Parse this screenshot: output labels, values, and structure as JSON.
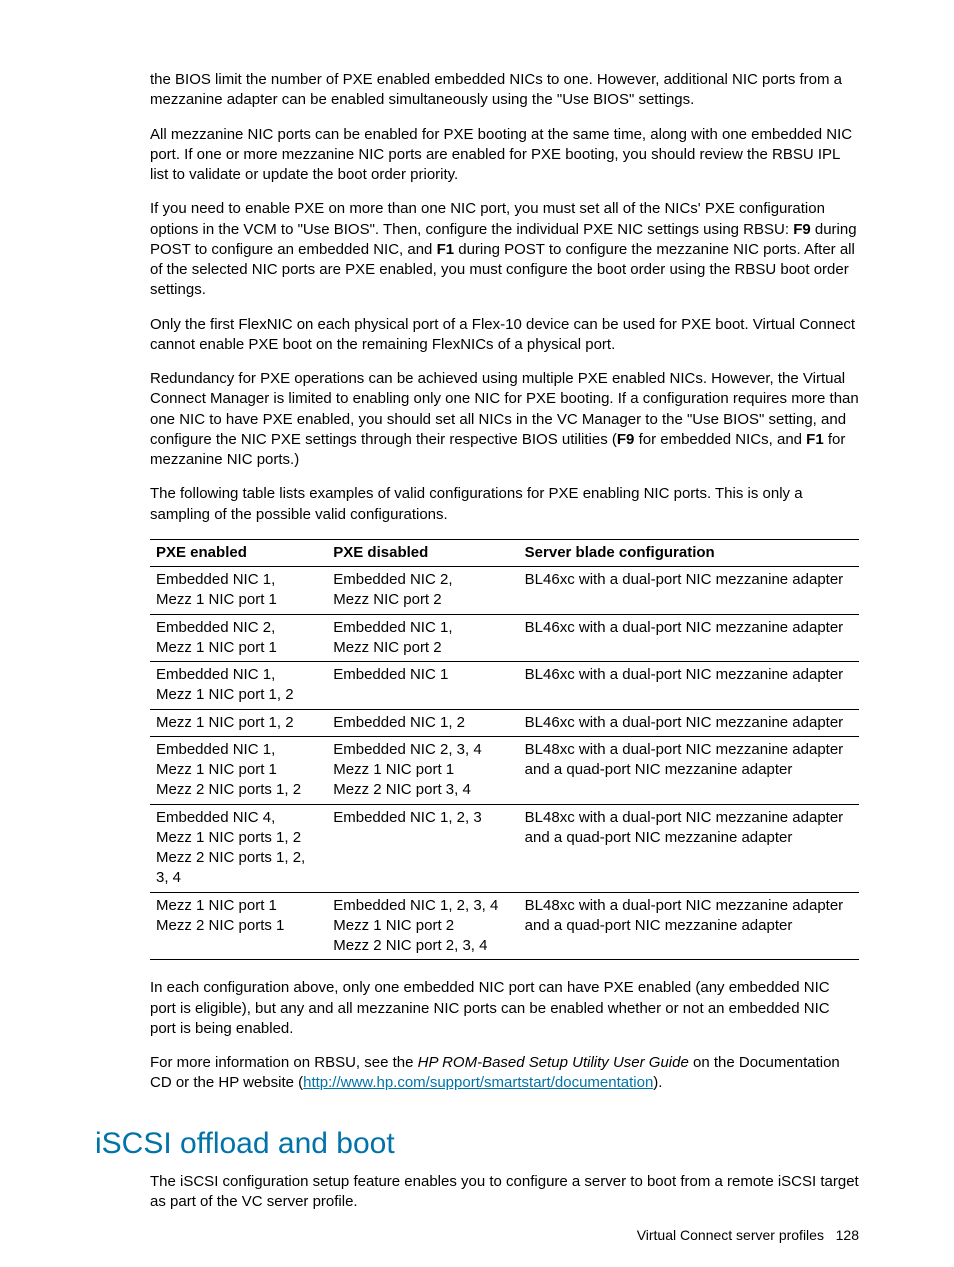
{
  "paragraphs": {
    "p1": "the BIOS limit the number of PXE enabled embedded NICs to one. However, additional NIC ports from a mezzanine adapter can be enabled simultaneously using the \"Use BIOS\" settings.",
    "p2": "All mezzanine NIC ports can be enabled for PXE booting at the same time, along with one embedded NIC port. If one or more mezzanine NIC ports are enabled for PXE booting, you should review the RBSU IPL list to validate or update the boot order priority.",
    "p3a": "If you need to enable PXE on more than one NIC port, you must set all of the NICs' PXE configuration options in the VCM to \"Use BIOS\". Then, configure the individual PXE NIC settings using RBSU: ",
    "p3b": "F9",
    "p3c": " during POST to configure an embedded NIC, and ",
    "p3d": "F1",
    "p3e": " during POST to configure the mezzanine NIC ports. After all of the selected NIC ports are PXE enabled, you must configure the boot order using the RBSU boot order settings.",
    "p4": "Only the first FlexNIC on each physical port of a Flex-10 device can be used for PXE boot. Virtual Connect cannot enable PXE boot on the remaining FlexNICs of a physical port.",
    "p5a": "Redundancy for PXE operations can be achieved using multiple PXE enabled NICs. However, the Virtual Connect Manager is limited to enabling only one NIC for PXE booting. If a configuration requires more than one NIC to have PXE enabled, you should set all NICs in the VC Manager to the \"Use BIOS\" setting, and configure the NIC PXE settings through their respective BIOS utilities (",
    "p5b": "F9",
    "p5c": " for embedded NICs, and ",
    "p5d": "F1",
    "p5e": " for mezzanine NIC ports.)",
    "p6": "The following table lists examples of valid configurations for PXE enabling NIC ports. This is only a sampling of the possible valid configurations.",
    "p7": "In each configuration above, only one embedded NIC port can have PXE enabled (any embedded NIC port is eligible), but any and all mezzanine NIC ports can be enabled whether or not an embedded NIC port is being enabled.",
    "p8a": "For more information on RBSU, see the ",
    "p8b": "HP ROM-Based Setup Utility User Guide",
    "p8c": " on the Documentation CD or the HP website (",
    "p8d": "http://www.hp.com/support/smartstart/documentation",
    "p8e": ").",
    "p9": "The iSCSI configuration setup feature enables you to configure a server to boot from a remote iSCSI target as part of the VC server profile."
  },
  "heading": "iSCSI offload and boot",
  "table": {
    "headers": [
      "PXE enabled",
      "PXE disabled",
      "Server blade configuration"
    ],
    "rows": [
      {
        "c1a": "Embedded NIC 1,",
        "c1b": "Mezz 1 NIC port 1",
        "c2a": "Embedded NIC 2,",
        "c2b": "Mezz NIC port 2",
        "c3": "BL46xc with a dual-port NIC mezzanine adapter"
      },
      {
        "c1a": "Embedded NIC 2,",
        "c1b": "Mezz 1 NIC port 1",
        "c2a": "Embedded NIC 1,",
        "c2b": "Mezz NIC port 2",
        "c3": "BL46xc with a dual-port NIC mezzanine adapter"
      },
      {
        "c1a": "Embedded NIC 1,",
        "c1b": "Mezz 1 NIC port 1, 2",
        "c2a": "Embedded NIC 1",
        "c2b": "",
        "c3": "BL46xc with a dual-port NIC mezzanine adapter"
      },
      {
        "c1a": "Mezz 1 NIC port 1, 2",
        "c1b": "",
        "c2a": "Embedded NIC 1, 2",
        "c2b": "",
        "c3": "BL46xc with a dual-port NIC mezzanine adapter"
      },
      {
        "c1a": "Embedded NIC 1,",
        "c1b": "Mezz 1 NIC port 1",
        "c1c": "Mezz 2 NIC ports 1, 2",
        "c2a": "Embedded NIC 2,   3, 4",
        "c2b": "Mezz 1 NIC port 1",
        "c2c": "Mezz 2 NIC port 3, 4",
        "c3": "BL48xc with a dual-port NIC mezzanine adapter and a quad-port NIC mezzanine adapter"
      },
      {
        "c1a": "Embedded NIC 4,",
        "c1b": "Mezz 1 NIC ports 1, 2",
        "c1c": "Mezz 2 NIC ports 1, 2, 3, 4",
        "c2a": "Embedded NIC 1, 2, 3",
        "c2b": "",
        "c2c": "",
        "c3": "BL48xc with a dual-port NIC mezzanine adapter and a quad-port NIC mezzanine adapter"
      },
      {
        "c1a": "Mezz 1 NIC port 1",
        "c1b": "Mezz 2 NIC ports 1",
        "c1c": "",
        "c2a": "Embedded NIC 1, 2, 3, 4",
        "c2b": "Mezz 1 NIC port 2",
        "c2c": "Mezz 2 NIC port 2, 3, 4",
        "c3": "BL48xc with a dual-port NIC mezzanine adapter and a quad-port NIC mezzanine adapter"
      }
    ]
  },
  "footer": {
    "label": "Virtual Connect server profiles",
    "page": "128"
  }
}
